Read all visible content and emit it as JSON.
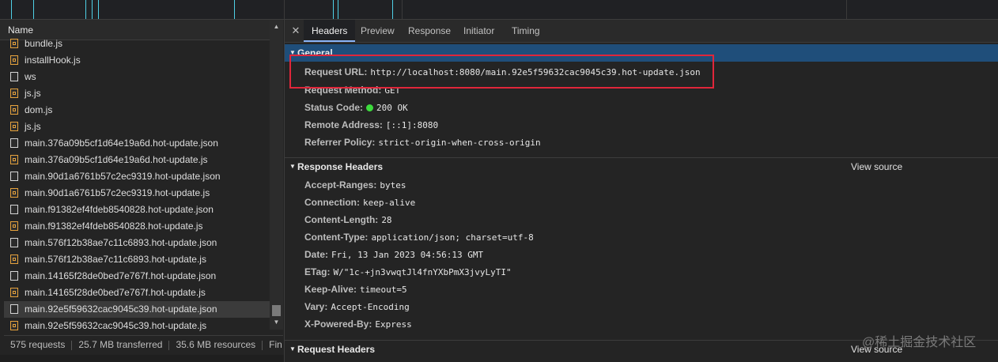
{
  "left_panel": {
    "name_header": "Name",
    "files": [
      {
        "name": "bundle.js",
        "type": "js"
      },
      {
        "name": "installHook.js",
        "type": "js"
      },
      {
        "name": "ws",
        "type": "doc"
      },
      {
        "name": "js.js",
        "type": "js"
      },
      {
        "name": "dom.js",
        "type": "js"
      },
      {
        "name": "js.js",
        "type": "js"
      },
      {
        "name": "main.376a09b5cf1d64e19a6d.hot-update.json",
        "type": "doc"
      },
      {
        "name": "main.376a09b5cf1d64e19a6d.hot-update.js",
        "type": "js"
      },
      {
        "name": "main.90d1a6761b57c2ec9319.hot-update.json",
        "type": "doc"
      },
      {
        "name": "main.90d1a6761b57c2ec9319.hot-update.js",
        "type": "js"
      },
      {
        "name": "main.f91382ef4fdeb8540828.hot-update.json",
        "type": "doc"
      },
      {
        "name": "main.f91382ef4fdeb8540828.hot-update.js",
        "type": "js"
      },
      {
        "name": "main.576f12b38ae7c11c6893.hot-update.json",
        "type": "doc"
      },
      {
        "name": "main.576f12b38ae7c11c6893.hot-update.js",
        "type": "js"
      },
      {
        "name": "main.14165f28de0bed7e767f.hot-update.json",
        "type": "doc"
      },
      {
        "name": "main.14165f28de0bed7e767f.hot-update.js",
        "type": "js"
      },
      {
        "name": "main.92e5f59632cac9045c39.hot-update.json",
        "type": "doc",
        "selected": true
      },
      {
        "name": "main.92e5f59632cac9045c39.hot-update.js",
        "type": "js"
      }
    ],
    "status": {
      "requests": "575 requests",
      "transferred": "25.7 MB transferred",
      "resources": "35.6 MB resources",
      "finish": "Fin"
    }
  },
  "tabs": [
    {
      "label": "Headers",
      "active": true
    },
    {
      "label": "Preview",
      "active": false
    },
    {
      "label": "Response",
      "active": false
    },
    {
      "label": "Initiator",
      "active": false
    },
    {
      "label": "Timing",
      "active": false
    }
  ],
  "general": {
    "title": "General",
    "request_url": {
      "key": "Request URL:",
      "value": "http://localhost:8080/main.92e5f59632cac9045c39.hot-update.json"
    },
    "request_method": {
      "key": "Request Method:",
      "value": "GET"
    },
    "status_code": {
      "key": "Status Code:",
      "value": "200 OK",
      "dot_color": "#3ddc3d"
    },
    "remote_address": {
      "key": "Remote Address:",
      "value": "[::1]:8080"
    },
    "referrer_policy": {
      "key": "Referrer Policy:",
      "value": "strict-origin-when-cross-origin"
    }
  },
  "response_headers": {
    "title": "Response Headers",
    "view_source": "View source",
    "items": [
      {
        "key": "Accept-Ranges:",
        "value": "bytes"
      },
      {
        "key": "Connection:",
        "value": "keep-alive"
      },
      {
        "key": "Content-Length:",
        "value": "28"
      },
      {
        "key": "Content-Type:",
        "value": "application/json; charset=utf-8"
      },
      {
        "key": "Date:",
        "value": "Fri, 13 Jan 2023 04:56:13 GMT"
      },
      {
        "key": "ETag:",
        "value": "W/\"1c-+jn3vwqtJl4fnYXbPmX3jvyLyTI\""
      },
      {
        "key": "Keep-Alive:",
        "value": "timeout=5"
      },
      {
        "key": "Vary:",
        "value": "Accept-Encoding"
      },
      {
        "key": "X-Powered-By:",
        "value": "Express"
      }
    ]
  },
  "request_headers": {
    "title": "Request Headers",
    "view_source": "View source"
  },
  "watermark": "@稀土掘金技术社区",
  "colors": {
    "general_header_bg": "#1f4e7a",
    "highlight_box": "#e0263a",
    "timeline_tick": "#4fd0e6"
  }
}
